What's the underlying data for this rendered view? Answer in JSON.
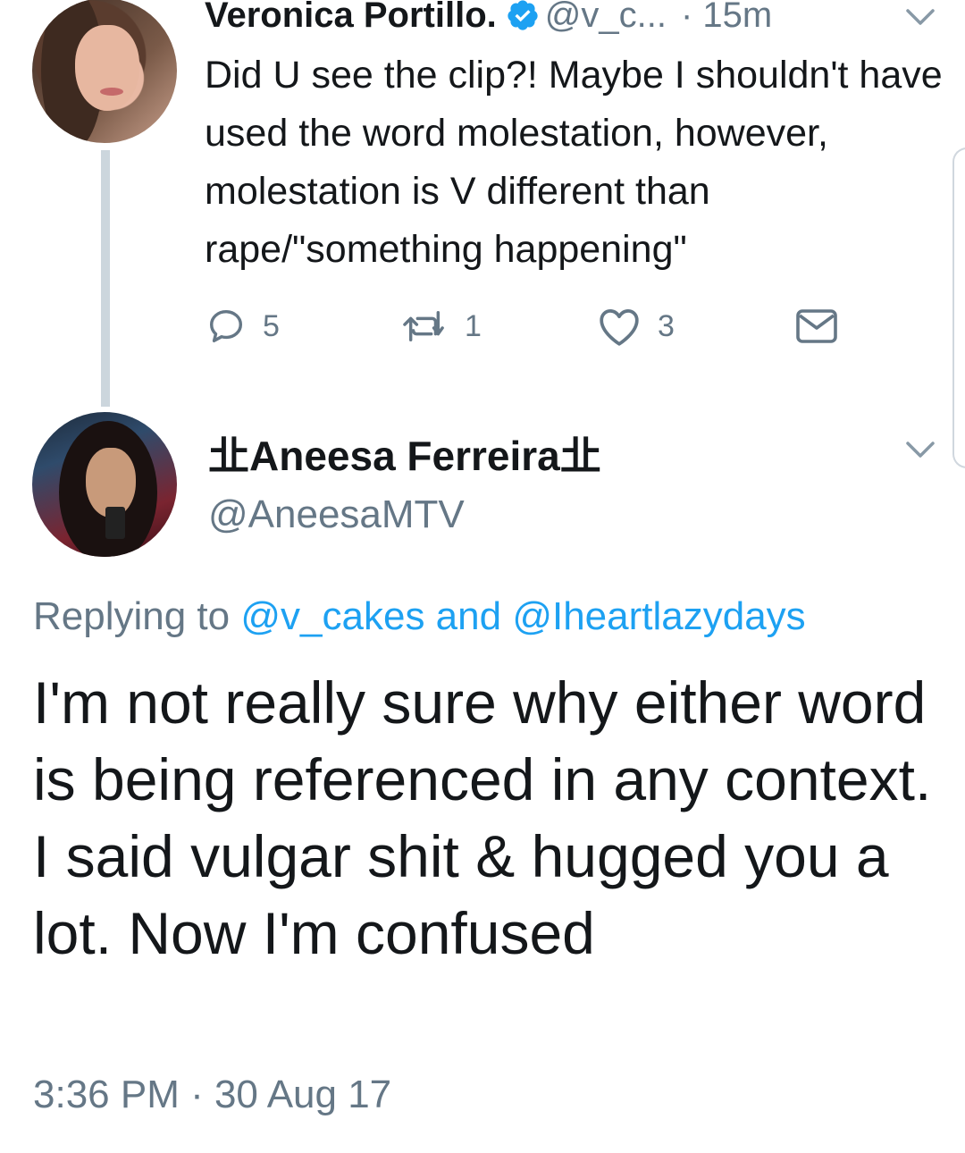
{
  "tweet1": {
    "name": "Veronica Portillo.",
    "handle": "@v_c...",
    "time": "· 15m",
    "text": "Did U see the clip?! Maybe I shouldn't have used the word molestation, however, molestation is V different than rape/\"something happening\"",
    "actions": {
      "reply_count": "5",
      "retweet_count": "1",
      "like_count": "3"
    },
    "icons": {
      "verified": "verified-badge-icon",
      "menu": "chevron-down-icon",
      "reply": "reply-icon",
      "retweet": "retweet-icon",
      "like": "heart-icon",
      "dm": "envelope-icon"
    }
  },
  "tweet2": {
    "name": "㐀Aneesa Ferreira㐀",
    "handle": "@AneesaMTV",
    "replying_prefix": "Replying to ",
    "mention1": "@v_cakes",
    "replying_and": " and ",
    "mention2": "@Iheartlazydays",
    "text": "I'm not really sure why either word is being referenced in any context. I said vulgar shit & hugged you a lot. Now I'm confused",
    "timestamp": "3:36 PM · 30 Aug 17",
    "icons": {
      "menu": "chevron-down-icon"
    }
  },
  "colors": {
    "text": "#14171a",
    "secondary": "#657786",
    "link": "#1da1f2",
    "verified": "#1da1f2",
    "thread_line": "#ccd6dd"
  }
}
